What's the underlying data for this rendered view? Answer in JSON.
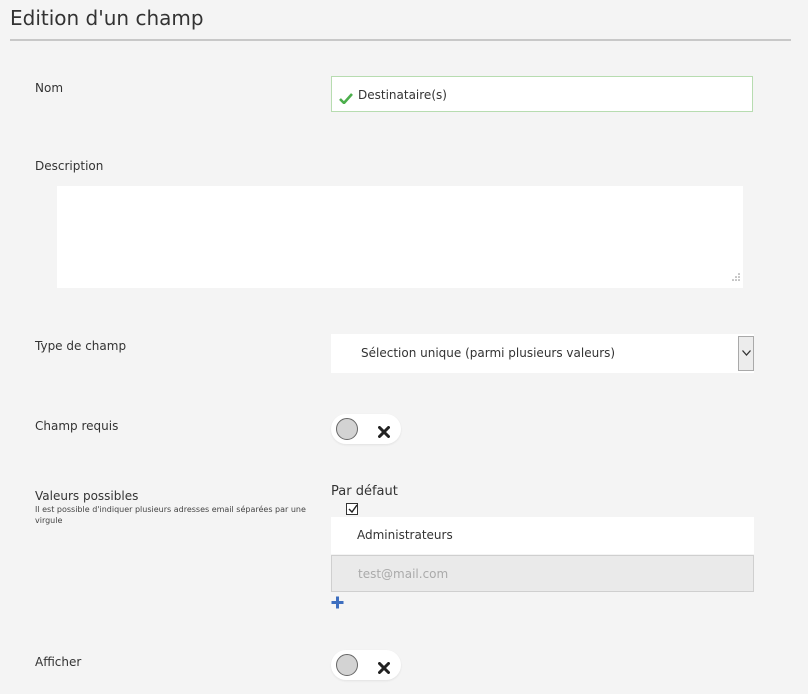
{
  "page": {
    "title": "Edition d'un champ"
  },
  "fields": {
    "name": {
      "label": "Nom",
      "value": "Destinataire(s)"
    },
    "description": {
      "label": "Description",
      "value": ""
    },
    "type": {
      "label": "Type de champ",
      "selected": "Sélection unique (parmi plusieurs valeurs)"
    },
    "required": {
      "label": "Champ requis",
      "enabled": false
    },
    "values": {
      "label": "Valeurs possibles",
      "hint": "Il est possible d'indiquer plusieurs adresses email séparées par une virgule",
      "default_label": "Par défaut",
      "default_checked": true,
      "items": [
        {
          "value": "Administrateurs"
        }
      ],
      "email_placeholder": "test@mail.com"
    },
    "display": {
      "label": "Afficher",
      "enabled": false
    }
  },
  "colors": {
    "check": "#4cae4c",
    "add": "#3d6ebf",
    "title_rule": "#c8c8c8"
  },
  "icons": [
    "check-icon",
    "resize-grip-icon",
    "chevron-down-icon",
    "close-icon",
    "checkbox-check-icon",
    "plus-icon"
  ]
}
